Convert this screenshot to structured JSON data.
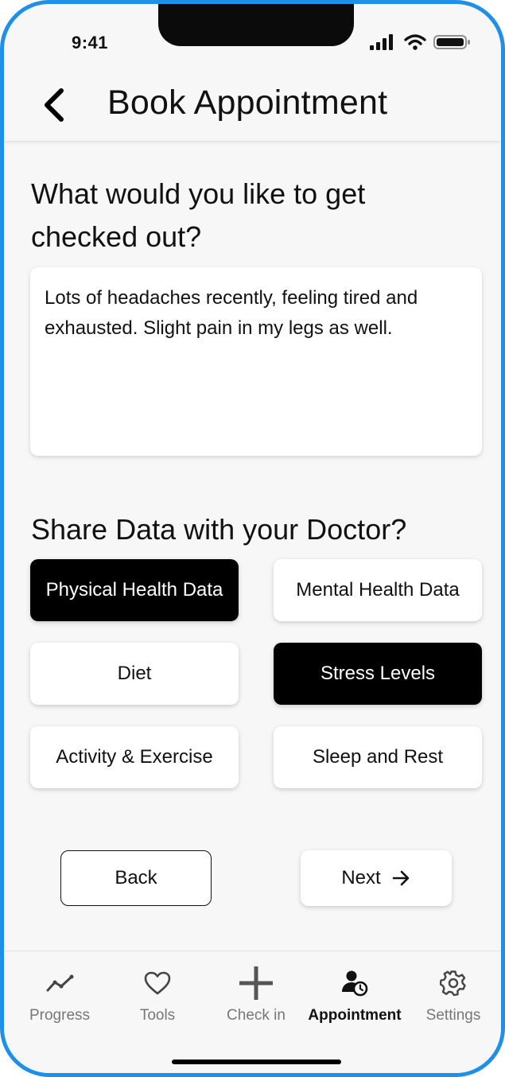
{
  "status": {
    "time": "9:41"
  },
  "header": {
    "title": "Book Appointment"
  },
  "question": "What would you like to get checked out?",
  "notes_value": "Lots of headaches recently, feeling tired and exhausted. Slight pain in my legs as well.",
  "share": {
    "title": "Share Data with your Doctor?",
    "options": [
      {
        "label": "Physical Health Data",
        "selected": true
      },
      {
        "label": "Mental Health Data",
        "selected": false
      },
      {
        "label": "Diet",
        "selected": false
      },
      {
        "label": "Stress Levels",
        "selected": true
      },
      {
        "label": "Activity & Exercise",
        "selected": false
      },
      {
        "label": "Sleep and Rest",
        "selected": false
      }
    ]
  },
  "actions": {
    "back_label": "Back",
    "next_label": "Next"
  },
  "tabs": [
    {
      "label": "Progress",
      "icon": "progress-chart-icon",
      "active": false
    },
    {
      "label": "Tools",
      "icon": "heart-icon",
      "active": false
    },
    {
      "label": "Check in",
      "icon": "plus-icon",
      "active": false
    },
    {
      "label": "Appointment",
      "icon": "user-clock-icon",
      "active": true
    },
    {
      "label": "Settings",
      "icon": "gear-icon",
      "active": false
    }
  ],
  "colors": {
    "frame": "#1e90e8",
    "background": "#f7f7f7",
    "selected_chip": "#000000",
    "inactive_tab": "#777777"
  }
}
